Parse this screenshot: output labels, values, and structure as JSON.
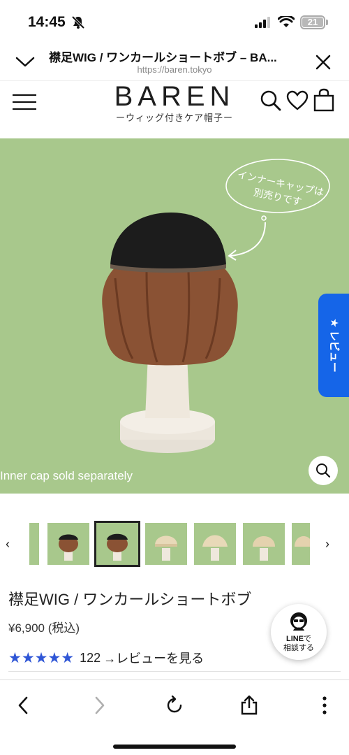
{
  "status_bar": {
    "time": "14:45",
    "battery": "21",
    "battery_level": 0.21
  },
  "browser": {
    "title": "襟足WIG / ワンカールショートボブ – BA...",
    "url": "https://baren.tokyo"
  },
  "site": {
    "logo": "BAREN",
    "tagline": "ーウィッグ付きケア帽子ー"
  },
  "hero": {
    "callout": "インナーキャップは\n別売りです",
    "caption": "Inner cap sold separately"
  },
  "review_tab": {
    "label": "★ レビュー"
  },
  "thumbnails": {
    "selected_index": 2,
    "count": 8
  },
  "product": {
    "name": "襟足WIG / ワンカールショートボブ",
    "price": "¥6,900 (税込)",
    "stars": "★★★★★",
    "rating_value": 5,
    "review_count": "122",
    "review_link": "→レビューを見る"
  },
  "line_button": {
    "brand": "LINE",
    "suffix": "で",
    "line2": "相談する"
  },
  "colors": {
    "hero_bg": "#a8c88c",
    "review_tab": "#1565e8",
    "stars": "#2f56d6"
  }
}
